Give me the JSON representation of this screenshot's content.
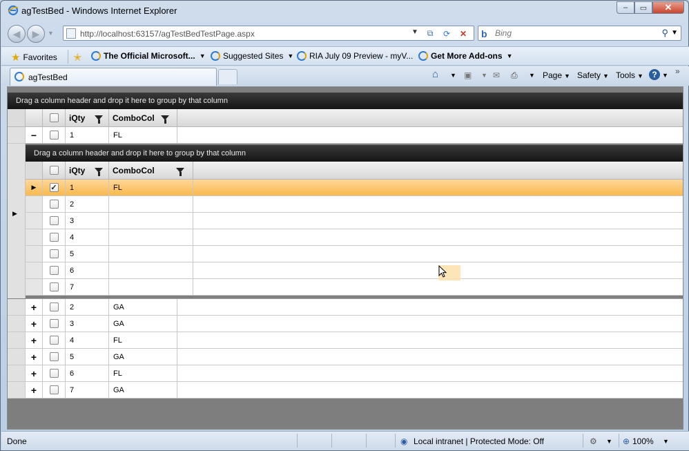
{
  "window": {
    "title": "agTestBed - Windows Internet Explorer",
    "minimize_label": "‒",
    "maximize_label": "▭",
    "close_label": "✕"
  },
  "address": {
    "url": "http://localhost:63157/agTestBedTestPage.aspx"
  },
  "search": {
    "placeholder": "Bing"
  },
  "favorites": {
    "favorites_label": "Favorites",
    "items": [
      {
        "label": "The Official Microsoft..."
      },
      {
        "label": "Suggested Sites"
      },
      {
        "label": "RIA July 09 Preview - myV..."
      },
      {
        "label": "Get More Add-ons"
      }
    ]
  },
  "tabs": [
    {
      "label": "agTestBed"
    }
  ],
  "commands": {
    "page": "Page",
    "safety": "Safety",
    "tools": "Tools",
    "help": "?",
    "more": "»"
  },
  "grid": {
    "group_prompt": "Drag a column header and drop it here to group by that column",
    "columns": [
      "iQty",
      "ComboCol"
    ],
    "outer_rows": [
      {
        "iqty": "1",
        "combo": "FL",
        "expander": "−"
      },
      {
        "iqty": "2",
        "combo": "GA",
        "expander": "+"
      },
      {
        "iqty": "3",
        "combo": "GA",
        "expander": "+"
      },
      {
        "iqty": "4",
        "combo": "FL",
        "expander": "+"
      },
      {
        "iqty": "5",
        "combo": "GA",
        "expander": "+"
      },
      {
        "iqty": "6",
        "combo": "FL",
        "expander": "+"
      },
      {
        "iqty": "7",
        "combo": "GA",
        "expander": "+"
      }
    ],
    "nested": {
      "group_prompt": "Drag a column header and drop it here to group by that column",
      "columns": [
        "iQty",
        "ComboCol"
      ],
      "rows": [
        {
          "iqty": "1",
          "combo": "FL",
          "checked": "✓",
          "selected": true
        },
        {
          "iqty": "2",
          "combo": "",
          "checked": ""
        },
        {
          "iqty": "3",
          "combo": "",
          "checked": ""
        },
        {
          "iqty": "4",
          "combo": "",
          "checked": ""
        },
        {
          "iqty": "5",
          "combo": "",
          "checked": ""
        },
        {
          "iqty": "6",
          "combo": "",
          "checked": ""
        },
        {
          "iqty": "7",
          "combo": "",
          "checked": ""
        }
      ]
    }
  },
  "status": {
    "text": "Done",
    "zone": "Local intranet | Protected Mode: Off",
    "zoom": "100%"
  },
  "colors": {
    "selected_row": "#f9b94d",
    "group_panel": "#1f1f1f",
    "content_bg": "#7e7e7e"
  }
}
